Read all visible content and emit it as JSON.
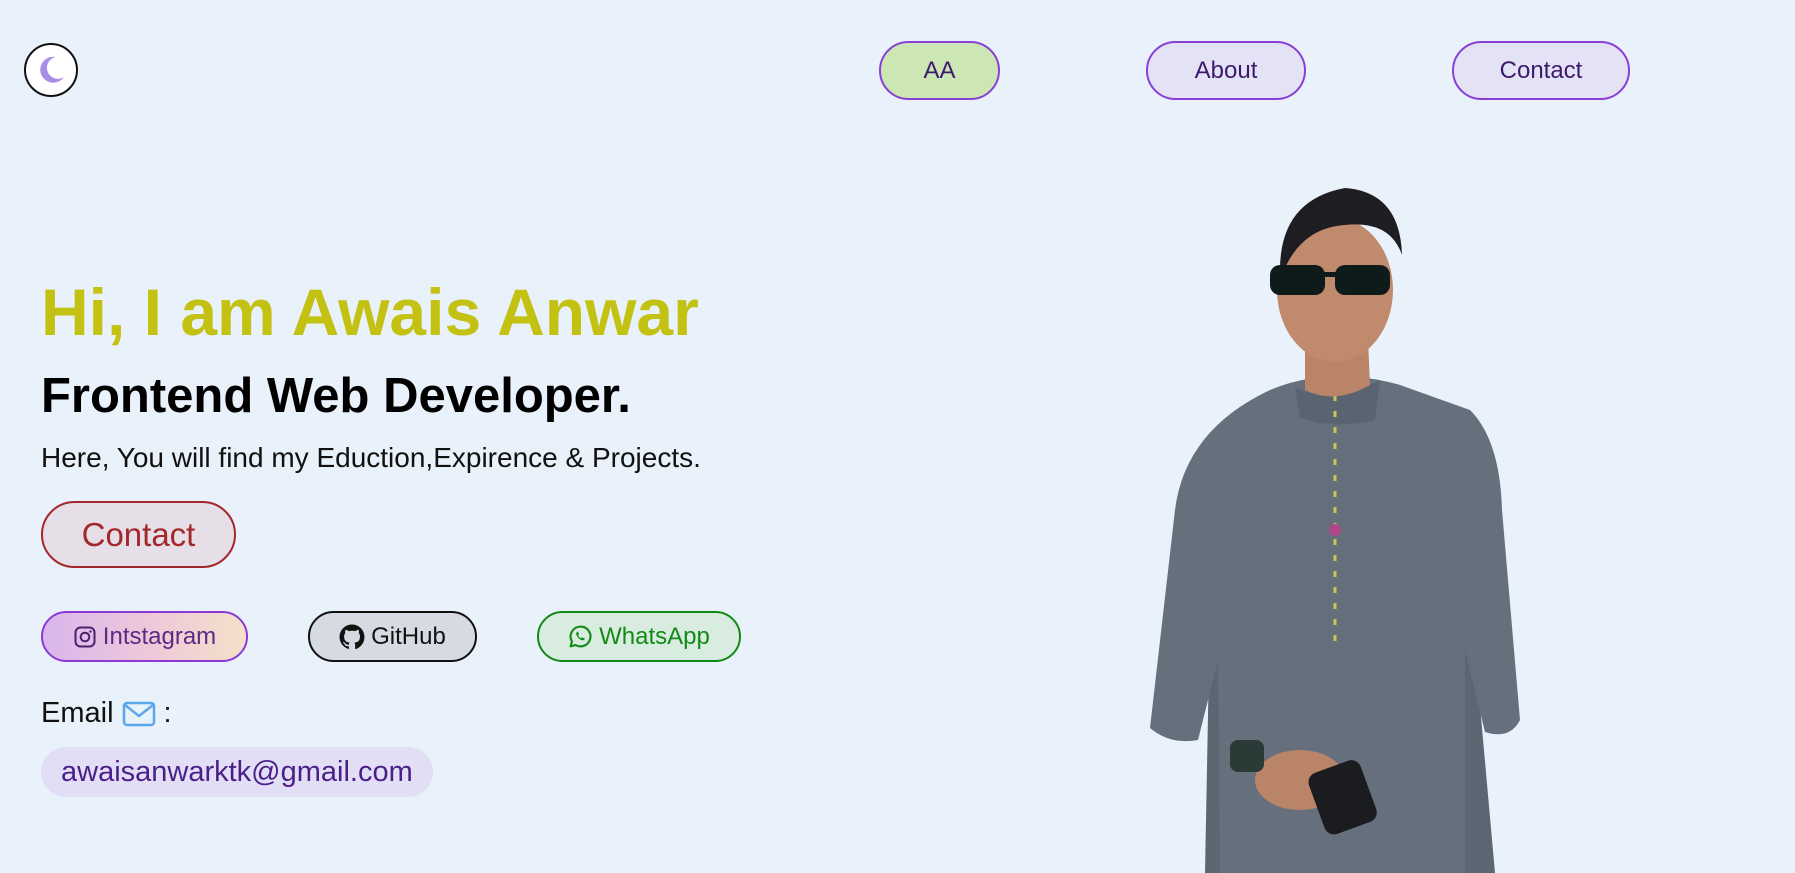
{
  "header": {
    "theme_toggle_icon": "moon-icon",
    "nav": [
      {
        "label": "AA"
      },
      {
        "label": "About"
      },
      {
        "label": "Contact"
      }
    ]
  },
  "hero": {
    "title": "Hi, I am Awais Anwar",
    "subtitle": "Frontend Web Developer.",
    "description": "Here, You will find my Eduction,Expirence & Projects.",
    "contact_button": "Contact"
  },
  "social": [
    {
      "label": "Intstagram",
      "icon": "instagram-icon"
    },
    {
      "label": "GitHub",
      "icon": "github-icon"
    },
    {
      "label": "WhatsApp",
      "icon": "whatsapp-icon"
    }
  ],
  "email": {
    "label": "Email",
    "separator": ":",
    "icon": "envelope-icon",
    "address": "awaisanwarktk@gmail.com"
  },
  "colors": {
    "background": "#e9f1fa",
    "title": "#c3c112",
    "nav_border": "#8a3fd6",
    "nav_active": "#cde7b4",
    "contact_accent": "#a3282b",
    "whatsapp": "#138a17"
  }
}
